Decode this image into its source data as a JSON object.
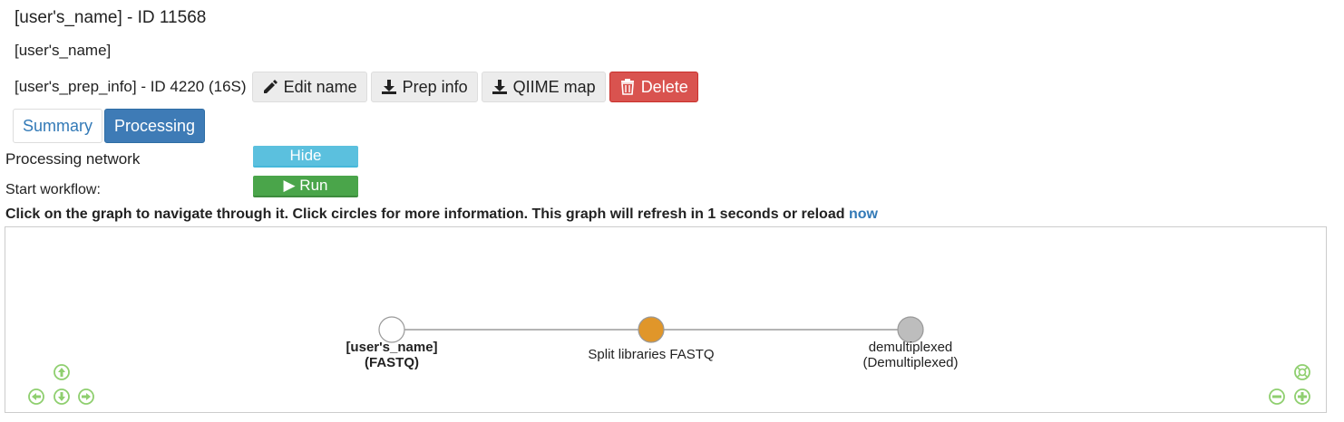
{
  "header": {
    "title": "[user's_name] - ID 11568",
    "subtitle": "[user's_name]"
  },
  "prep": {
    "label": "[user's_prep_info] - ID 4220 (16S)",
    "buttons": {
      "edit": "Edit name",
      "prep_info": "Prep info",
      "qiime_map": "QIIME map",
      "delete": "Delete"
    }
  },
  "tabs": {
    "summary": "Summary",
    "processing": "Processing"
  },
  "processing": {
    "network_label": "Processing network",
    "hide_label": "Hide",
    "start_label": "Start workflow:",
    "run_label": "▶ Run"
  },
  "info": {
    "text": "Click on the graph to navigate through it. Click circles for more information. This graph will refresh in 1 seconds or reload ",
    "link": "now"
  },
  "graph": {
    "nodes": [
      {
        "label_line1": "[user's_name]",
        "label_line2": "(FASTQ)",
        "fill": "#ffffff",
        "bold": true
      },
      {
        "label_line1": "Split libraries FASTQ",
        "label_line2": "",
        "fill": "#e0962a",
        "bold": false
      },
      {
        "label_line1": "demultiplexed",
        "label_line2": "(Demultiplexed)",
        "fill": "#bdbdbd",
        "bold": false
      }
    ],
    "nav_color": "#8fcf6f"
  }
}
